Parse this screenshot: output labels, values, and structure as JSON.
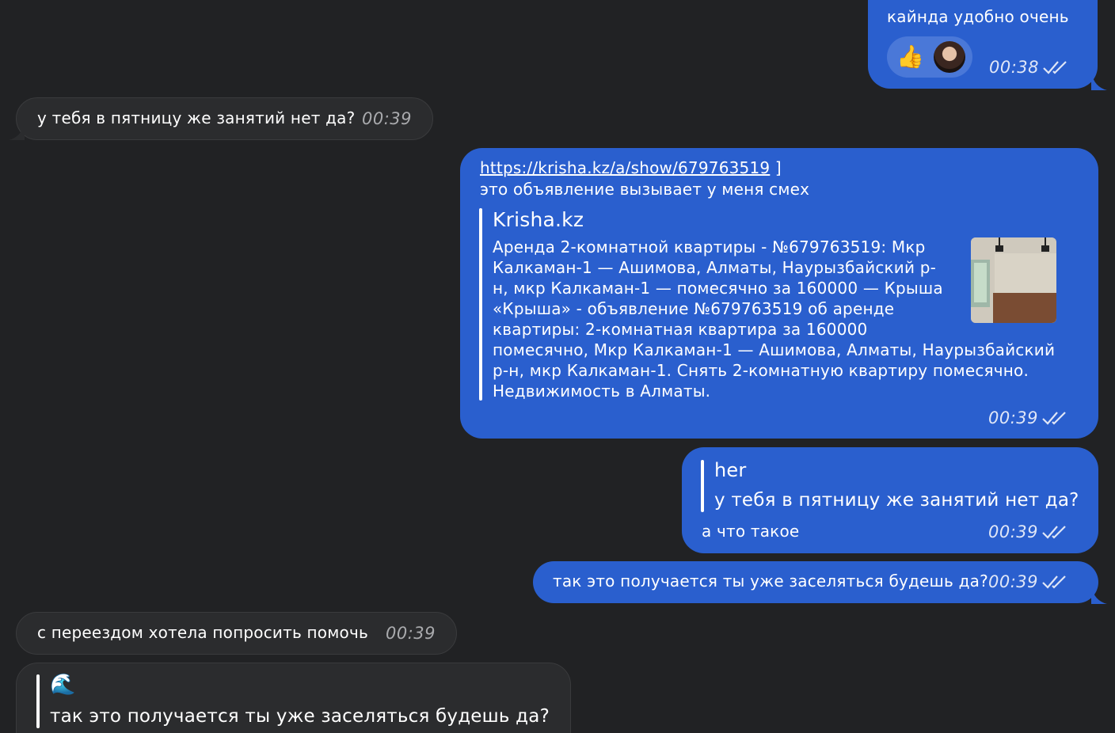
{
  "messages": {
    "m1": {
      "text": "кайнда удобно очень",
      "time": "00:38",
      "reaction": "👍"
    },
    "m2": {
      "text": "у тебя в пятницу же занятий нет да?",
      "time": "00:39"
    },
    "m3": {
      "link": "https://krisha.kz/a/show/679763519",
      "link_suffix": " ]",
      "text": "это объявление вызывает у меня смех",
      "preview_site": "Krisha.kz",
      "preview_title_lines": [
        "Аренда 2-комнатной квартиры - №679763519: Мкр",
        "Калкаман-1 — Ашимова, Алматы, Наурызбайский р-",
        "н, мкр Калкаман-1 — помесячно за 160000 — Крыша"
      ],
      "preview_desc_lines": [
        "«Крыша» - объявление №679763519 об аренде",
        "квартиры: 2-комнатная квартира за 160000",
        "помесячно, Мкр Калкаман-1 — Ашимова, Алматы, Наурызбайский",
        "р-н, мкр Калкаман-1. Снять 2-комнатную квартиру помесячно.",
        "Недвижимость в Алматы."
      ],
      "time": "00:39"
    },
    "m4": {
      "reply_author": "her",
      "reply_text": "у тебя в пятницу же занятий нет да?",
      "text": "а что такое",
      "time": "00:39"
    },
    "m5": {
      "text": "так это получается ты уже заселяться будешь да?",
      "time": "00:39"
    },
    "m6": {
      "text": "с переездом хотела попросить помочь",
      "time": "00:39"
    },
    "m7": {
      "reply_author": "🌊",
      "reply_text": "так это получается ты уже заселяться будешь да?"
    }
  },
  "colors": {
    "background": "#212224",
    "outgoing": "#2a5fce",
    "incoming": "#2b2c2e"
  }
}
